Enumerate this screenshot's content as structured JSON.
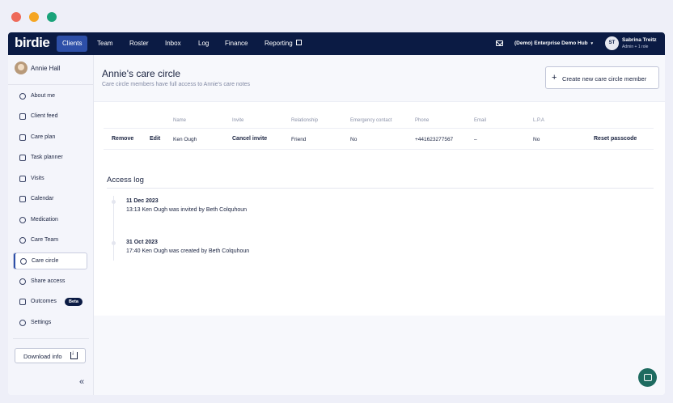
{
  "window_controls": {
    "close_color": "#ee6a5a",
    "minimize_color": "#f5a623",
    "maximize_color": "#1aa37a"
  },
  "topnav": {
    "logo": "birdie",
    "items": [
      {
        "label": "Clients",
        "active": true
      },
      {
        "label": "Team"
      },
      {
        "label": "Roster"
      },
      {
        "label": "Inbox"
      },
      {
        "label": "Log"
      },
      {
        "label": "Finance"
      },
      {
        "label": "Reporting"
      }
    ],
    "hub": "(Demo) Enterprise Demo Hub",
    "user": {
      "initials": "ST",
      "name": "Sabrina Treitz",
      "role": "Admin + 1 role"
    }
  },
  "sidebar": {
    "client_name": "Annie Hall",
    "items": [
      {
        "label": "About me"
      },
      {
        "label": "Client feed"
      },
      {
        "label": "Care plan"
      },
      {
        "label": "Task planner"
      },
      {
        "label": "Visits"
      },
      {
        "label": "Calendar"
      },
      {
        "label": "Medication"
      },
      {
        "label": "Care Team"
      },
      {
        "label": "Care circle",
        "active": true
      },
      {
        "label": "Share access"
      },
      {
        "label": "Outcomes",
        "badge": "Beta"
      },
      {
        "label": "Settings"
      }
    ],
    "download_label": "Download info",
    "collapse_glyph": "«"
  },
  "main": {
    "title": "Annie's care circle",
    "subtitle": "Care circle members have full access to Annie's care notes",
    "create_button": "Create new care circle member",
    "table": {
      "headers": [
        "Name",
        "Invite",
        "Relationship",
        "Emergency contact",
        "Phone",
        "Email",
        "L.P.A"
      ],
      "rows": [
        {
          "remove": "Remove",
          "edit": "Edit",
          "name": "Ken Ough",
          "invite": "Cancel invite",
          "relationship": "Friend",
          "emergency_contact": "No",
          "phone": "+441623277567",
          "email": "–",
          "lpa": "No",
          "action": "Reset passcode"
        }
      ]
    },
    "access_log": {
      "title": "Access log",
      "entries": [
        {
          "date": "11 Dec 2023",
          "text": "13:13 Ken Ough was invited by Beth Colquhoun"
        },
        {
          "date": "31 Oct 2023",
          "text": "17:40 Ken Ough was created by Beth Colquhoun"
        }
      ]
    }
  },
  "colors": {
    "nav_bg": "#0b1b44",
    "accent": "#2d4fa8",
    "chat_button": "#1e6b60"
  }
}
